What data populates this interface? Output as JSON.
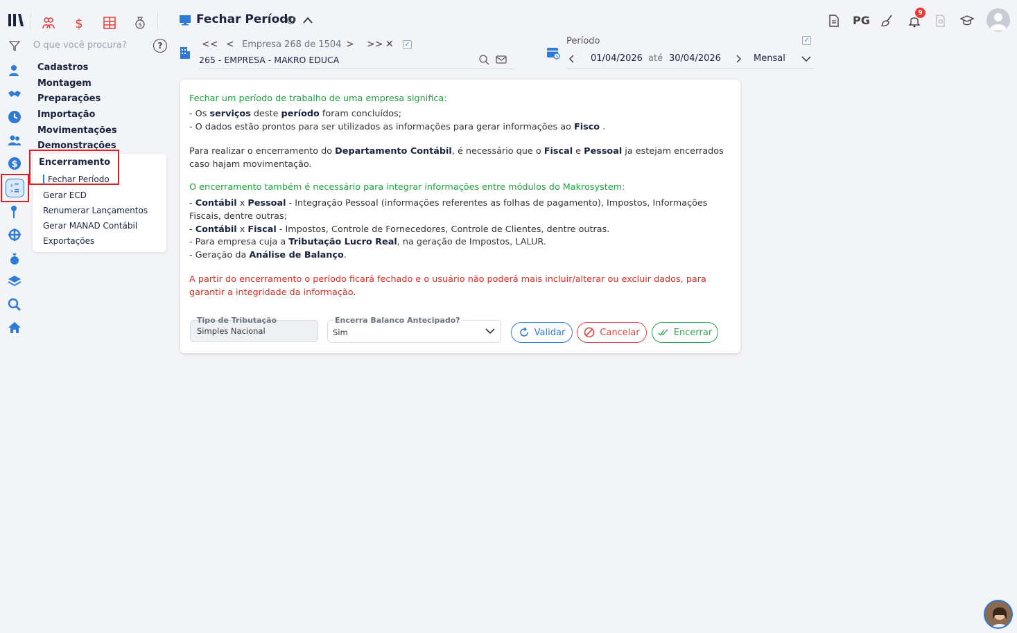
{
  "header": {
    "title": "Fechar Período",
    "search_placeholder": "O que você procura?"
  },
  "topbar": {
    "pg_label": "PG",
    "notification_count": "9"
  },
  "menu": {
    "items": [
      "Cadastros",
      "Montagem",
      "Preparações",
      "Importação",
      "Movimentações",
      "Demonstrações"
    ],
    "submenu_title": "Encerramento",
    "submenu_items": [
      "Fechar Período",
      "Gerar ECD",
      "Renumerar Lançamentos",
      "Gerar MANAD Contábil",
      "Exportações"
    ]
  },
  "company": {
    "first": "<<",
    "prev": "<",
    "counter": "Empresa 268 de 1504",
    "next": ">",
    "last": ">>",
    "close": "✕",
    "name": "265 - EMPRESA - MAKRO EDUCA"
  },
  "period": {
    "label": "Período",
    "start": "01/04/2026",
    "ate": "até",
    "end": "30/04/2026",
    "type": "Mensal"
  },
  "content": {
    "p1_title": "Fechar um período de trabalho de uma empresa significa:",
    "p1_l1_a": "- Os ",
    "p1_l1_b": "serviços",
    "p1_l1_c": " deste ",
    "p1_l1_d": "período",
    "p1_l1_e": " foram concluídos;",
    "p1_l2_a": "- O dados estão prontos para ser utilizados as informações para gerar informações ao ",
    "p1_l2_b": "Fisco",
    "p1_l2_c": " .",
    "p2_a": "Para realizar o encerramento do ",
    "p2_b": "Departamento Contábil",
    "p2_c": ", é necessário que o ",
    "p2_d": "Fiscal",
    "p2_e": " e ",
    "p2_f": "Pessoal",
    "p2_g": " ja estejam encerrados caso hajam movimentação.",
    "p3_title": "O encerramento também é necessário para integrar informações entre módulos do Makrosystem:",
    "l1_a": "- ",
    "l1_b": "Contábil",
    "l1_c": " x ",
    "l1_d": "Pessoal",
    "l1_e": " - Integração Pessoal (informações referentes as folhas de pagamento), Impostos, Informações Fiscais, dentre outras;",
    "l2_a": "- ",
    "l2_b": "Contábil",
    "l2_c": " x ",
    "l2_d": "Fiscal",
    "l2_e": " - Impostos, Controle de Fornecedores, Controle de Clientes, dentre outras.",
    "l3_a": "- Para empresa cuja a ",
    "l3_b": "Tributação Lucro Real",
    "l3_c": ", na geração de Impostos, LALUR.",
    "l4_a": "- Geração da ",
    "l4_b": "Análise de Balanço",
    "l4_c": ".",
    "warning": "A partir do encerramento o período ficará fechado e o usuário não poderá mais incluir/alterar ou excluir dados, para garantir a integridade da informação."
  },
  "form": {
    "tipo_label": "Tipo de Tributação",
    "tipo_value": "Simples Nacional",
    "encerra_label": "Encerra Balanco Antecipado?",
    "encerra_value": "Sim"
  },
  "buttons": {
    "validar": "Validar",
    "cancelar": "Cancelar",
    "encerrar": "Encerrar"
  },
  "colors": {
    "accent": "#2e7bd6",
    "highlight": "#e11d20",
    "green": "#1aa33b",
    "red": "#d92d20"
  }
}
